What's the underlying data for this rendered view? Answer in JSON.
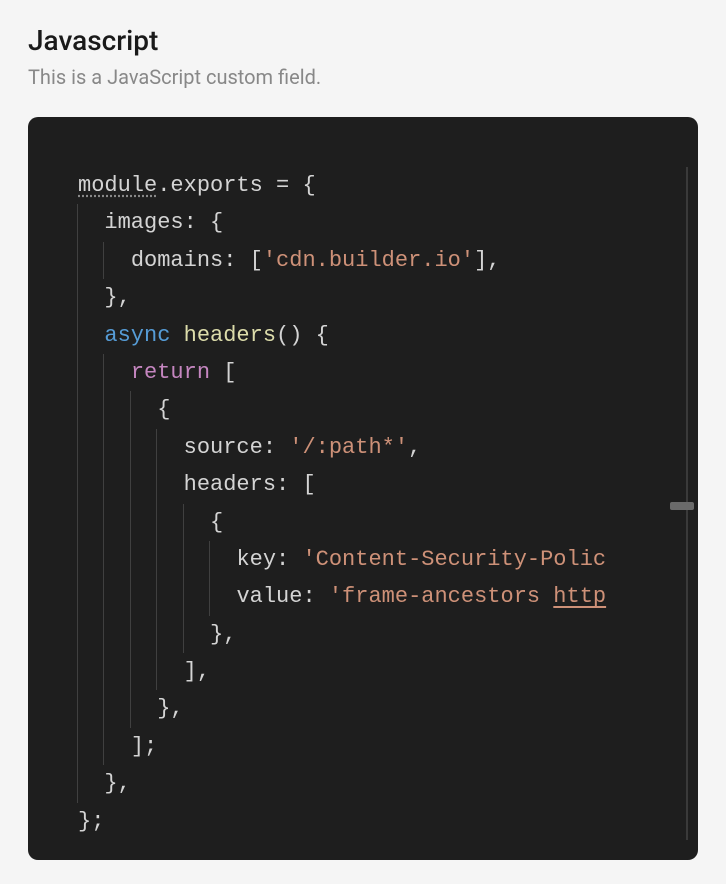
{
  "header": {
    "title": "Javascript",
    "subtitle": "This is a JavaScript custom field."
  },
  "code": {
    "tokens": {
      "module": "module",
      "dot": ".",
      "exports": "exports",
      "eq": " = ",
      "lbrace": "{",
      "rbrace": "}",
      "images": "images",
      "colon": ": ",
      "domains": "domains",
      "lbracket": "[",
      "rbracket": "]",
      "str_cdn": "'cdn.builder.io'",
      "comma": ",",
      "async": "async",
      "headers_fn": "headers",
      "parens": "()",
      "return": "return",
      "source": "source",
      "str_path": "'/:path*'",
      "headers_prop": "headers",
      "key": "key",
      "str_csp": "'Content-Security-Polic",
      "value": "value",
      "str_frame1": "'frame-ancestors ",
      "str_http": "http",
      "semi": ";"
    }
  }
}
